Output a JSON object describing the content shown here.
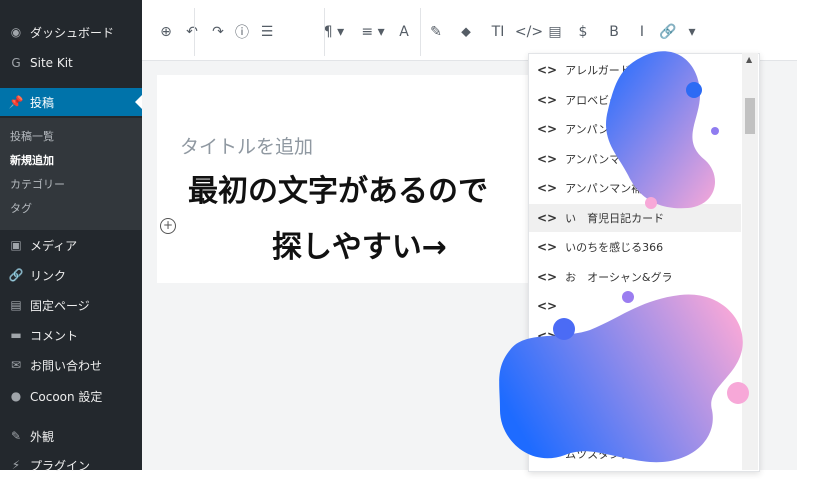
{
  "sidebar": {
    "items": [
      {
        "label": "ダッシュボード",
        "icon": "dashboard-icon",
        "glyph": "◉"
      },
      {
        "label": "Site Kit",
        "icon": "sitekit-icon",
        "glyph": "G"
      },
      {
        "label": "投稿",
        "icon": "pin-icon",
        "glyph": "📌"
      },
      {
        "label": "メディア",
        "icon": "media-icon",
        "glyph": "▣"
      },
      {
        "label": "リンク",
        "icon": "link-icon",
        "glyph": "🔗"
      },
      {
        "label": "固定ページ",
        "icon": "page-icon",
        "glyph": "▤"
      },
      {
        "label": "コメント",
        "icon": "comment-icon",
        "glyph": "▬"
      },
      {
        "label": "お問い合わせ",
        "icon": "mail-icon",
        "glyph": "✉"
      },
      {
        "label": "Cocoon 設定",
        "icon": "cocoon-icon",
        "glyph": "●"
      },
      {
        "label": "外観",
        "icon": "appearance-icon",
        "glyph": "✎"
      },
      {
        "label": "プラグイン",
        "icon": "plugin-icon",
        "glyph": "⚡"
      }
    ],
    "submenu": [
      "投稿一覧",
      "新規追加",
      "カテゴリー",
      "タグ"
    ]
  },
  "toolbar": {
    "icons": [
      "add-block-icon",
      "undo-icon",
      "redo-icon",
      "info-icon",
      "outline-icon",
      "paragraph-icon",
      "align-icon",
      "font-icon",
      "highlight-icon",
      "tag-icon",
      "text-size-icon",
      "code-icon",
      "file-icon",
      "dollar-icon",
      "bold-icon",
      "italic-icon",
      "link-icon",
      "more-icon"
    ],
    "glyphs": [
      "⊕",
      "↶",
      "↷",
      "ⓘ",
      "☰",
      "¶ ▾",
      "≡ ▾",
      "A",
      "✎",
      "⬥",
      "TI",
      "</>",
      "▤",
      "$",
      "B",
      "I",
      "🔗",
      "▾"
    ]
  },
  "editor": {
    "title_placeholder": "タイトルを追加"
  },
  "dropdown": {
    "items": [
      "アレルガード",
      "アロベビー",
      "アンパンマ",
      "アンパンマ",
      "アンパンマン補助便座",
      "い　育児日記カード",
      "いのちを感じる366",
      "お　オーシャン&グラ",
      "",
      "",
      "",
      "",
      "",
      "ムツスタンプ"
    ],
    "code_glyph": "<>"
  },
  "overlay": {
    "line1": "最初の文字があるので",
    "line2": "探しやすい→"
  },
  "colors": {
    "sidebar_bg": "#23282d",
    "active_bg": "#0073aa",
    "blob_start": "#1e6bff",
    "blob_end": "#f7a8d8"
  }
}
